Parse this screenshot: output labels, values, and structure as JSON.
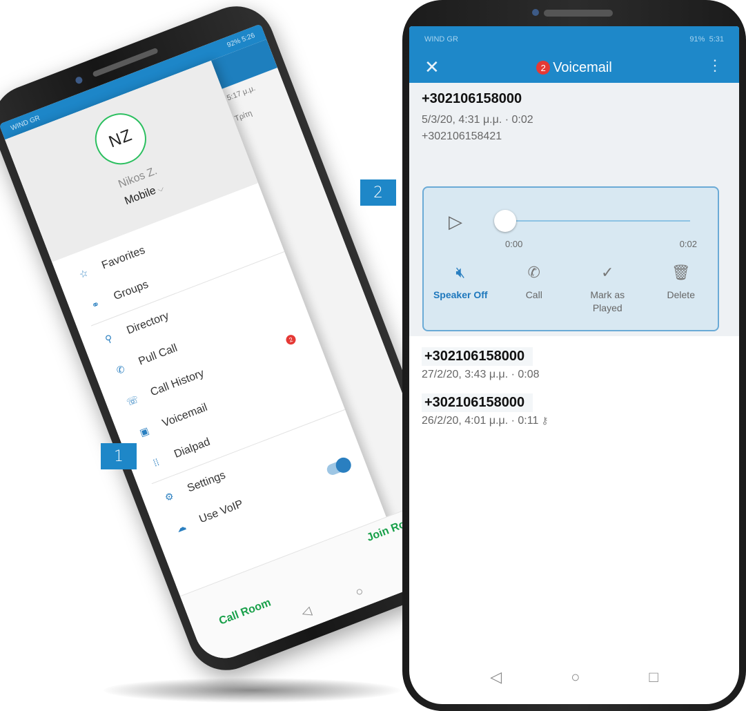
{
  "left_phone": {
    "status": {
      "carrier": "WIND GR",
      "battery": "92%",
      "time": "5:26"
    },
    "background_app": {
      "time_label": "5:17 μ.μ.",
      "day_label": "Τρίτη"
    },
    "drawer": {
      "avatar_initials": "NZ",
      "user_name": "Nikos Z.",
      "mode": "Mobile",
      "items": [
        {
          "label": "Favorites",
          "icon": "star-icon"
        },
        {
          "label": "Groups",
          "icon": "groups-icon"
        },
        {
          "label": "Directory",
          "icon": "search-icon"
        },
        {
          "label": "Pull Call",
          "icon": "pull-call-icon"
        },
        {
          "label": "Call History",
          "icon": "call-history-icon",
          "badge": "2"
        },
        {
          "label": "Voicemail",
          "icon": "voicemail-icon"
        },
        {
          "label": "Dialpad",
          "icon": "dialpad-icon"
        },
        {
          "label": "Settings",
          "icon": "gear-icon"
        },
        {
          "label": "Use VoIP",
          "icon": "cloud-icon",
          "toggle_on": true
        }
      ]
    },
    "bottom": {
      "join_room": "Join Room",
      "call_room": "Call Room"
    }
  },
  "right_phone": {
    "status": {
      "carrier": "WIND GR",
      "battery": "91%",
      "time": "5:31"
    },
    "header": {
      "badge": "2",
      "title": "Voicemail"
    },
    "selected": {
      "number": "+302106158000",
      "meta": "5/3/20, 4:31 μ.μ. · 0:02",
      "callee": "+302106158421",
      "player": {
        "current": "0:00",
        "duration": "0:02",
        "progress": 0.0
      },
      "actions": [
        {
          "label": "Speaker Off",
          "icon": "speaker-off-icon",
          "active": true
        },
        {
          "label": "Call",
          "icon": "phone-icon",
          "active": false
        },
        {
          "label": "Mark as Played",
          "icon": "checkmark-icon",
          "active": false
        },
        {
          "label": "Delete",
          "icon": "trash-icon",
          "active": false
        }
      ]
    },
    "list": [
      {
        "number": "+302106158000",
        "meta": "27/2/20, 3:43 μ.μ. · 0:08"
      },
      {
        "number": "+302106158000",
        "meta": "26/2/20, 4:01 μ.μ. · 0:11"
      }
    ]
  },
  "callouts": {
    "one": "1",
    "two": "2"
  },
  "colors": {
    "primary": "#1e88c9",
    "accent_green": "#19a04a",
    "badge_red": "#e53935"
  }
}
